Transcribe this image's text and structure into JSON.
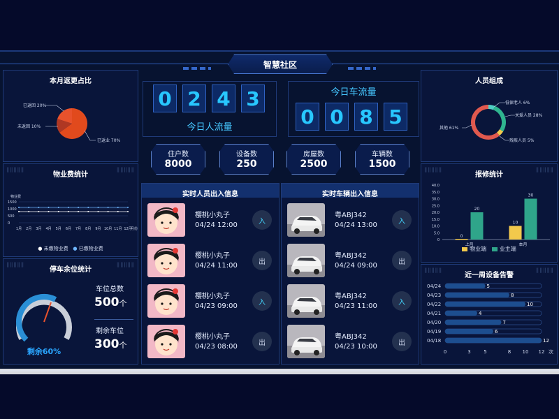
{
  "app": {
    "title": "智慧社区"
  },
  "vacancy_ratio": {
    "title": "本月返更占比",
    "slices": [
      {
        "label": "已返回 20%",
        "value": 20
      },
      {
        "label": "未返回 10%",
        "value": 10
      },
      {
        "label": "已返业 70%",
        "value": 70
      }
    ]
  },
  "fee_stats": {
    "title": "物业费统计",
    "y_label": "物业费",
    "x_labels": [
      "1月",
      "2月",
      "3月",
      "4月",
      "5月",
      "6月",
      "7月",
      "8月",
      "9月",
      "10月",
      "11月",
      "12月"
    ],
    "x_unit": "月份",
    "y_ticks": [
      "1500",
      "1000",
      "500",
      "0"
    ],
    "legend": [
      "未缴物业费",
      "已缴物业费"
    ]
  },
  "parking": {
    "title": "停车余位统计",
    "gauge_label": "剩余60%",
    "remaining_pct": 60,
    "total_label": "车位总数",
    "total_value": "500",
    "total_unit": "个",
    "remain_label": "剩余车位",
    "remain_value": "300",
    "remain_unit": "个"
  },
  "people_flow": {
    "digits": [
      "0",
      "2",
      "4",
      "3"
    ],
    "label": "今日人流量"
  },
  "car_flow": {
    "digits": [
      "0",
      "0",
      "8",
      "5"
    ],
    "label": "今日车流量"
  },
  "stats": [
    {
      "label": "住户数",
      "value": "8000"
    },
    {
      "label": "设备数",
      "value": "250"
    },
    {
      "label": "房屋数",
      "value": "2500"
    },
    {
      "label": "车辆数",
      "value": "1500"
    }
  ],
  "person_records": {
    "title": "实时人员出入信息",
    "items": [
      {
        "name": "樱桃小丸子",
        "time": "04/24 12:00",
        "action": "入"
      },
      {
        "name": "樱桃小丸子",
        "time": "04/24 11:00",
        "action": "出"
      },
      {
        "name": "樱桃小丸子",
        "time": "04/23 09:00",
        "action": "入"
      },
      {
        "name": "樱桃小丸子",
        "time": "04/23 08:00",
        "action": "出"
      }
    ]
  },
  "car_records": {
    "title": "实时车辆出入信息",
    "items": [
      {
        "plate": "粤ABJ342",
        "time": "04/24 13:00",
        "action": "入"
      },
      {
        "plate": "粤ABJ342",
        "time": "04/24 09:00",
        "action": "出"
      },
      {
        "plate": "粤ABJ342",
        "time": "04/23 11:00",
        "action": "入"
      },
      {
        "plate": "粤ABJ342",
        "time": "04/23 10:00",
        "action": "出"
      }
    ]
  },
  "composition": {
    "title": "人员组成",
    "slices": [
      {
        "label": "低保老人 6%",
        "value": 6,
        "color": "#4fd1c5"
      },
      {
        "label": "关爱人员 28%",
        "value": 28,
        "color": "#2fb58f"
      },
      {
        "label": "残疾人员 5%",
        "value": 5,
        "color": "#f2c94c"
      },
      {
        "label": "其他 61%",
        "value": 61,
        "color": "#e0594e"
      }
    ]
  },
  "repair": {
    "title": "报修统计",
    "y_ticks": [
      "40.0",
      "35.0",
      "30.0",
      "25.0",
      "20.0",
      "15.0",
      "10.0",
      "5.0",
      "0"
    ],
    "chart_data": {
      "type": "bar",
      "categories": [
        "上月",
        "本月"
      ],
      "series": [
        {
          "name": "物业端",
          "values": [
            0,
            10
          ],
          "color": "#f2c94c"
        },
        {
          "name": "业主端",
          "values": [
            20,
            30
          ],
          "color": "#2fa58a"
        }
      ],
      "ylim": [
        0,
        40
      ]
    }
  },
  "alerts": {
    "title": "近一周设备告警",
    "x_ticks": [
      "0",
      "3",
      "5",
      "8",
      "10",
      "12"
    ],
    "x_unit": "次",
    "chart_data": {
      "type": "bar",
      "categories": [
        "04/24",
        "04/23",
        "04/22",
        "04/21",
        "04/20",
        "04/19",
        "04/18"
      ],
      "values": [
        5,
        8,
        10,
        4,
        7,
        6,
        12
      ],
      "xlim": [
        0,
        12
      ]
    }
  }
}
